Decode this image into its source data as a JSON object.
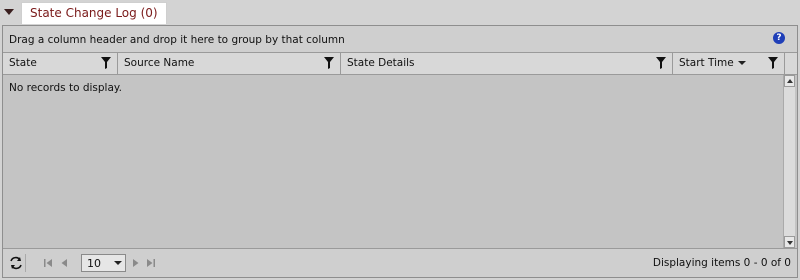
{
  "section": {
    "title": "State Change Log (0)"
  },
  "grid": {
    "group_panel_text": "Drag a column header and drop it here to group by that column",
    "help_label": "?",
    "columns": [
      {
        "label": "State"
      },
      {
        "label": "Source Name"
      },
      {
        "label": "State Details"
      },
      {
        "label": "Start Time"
      }
    ],
    "empty_text": "No records to display."
  },
  "pager": {
    "page_size": "10",
    "info": "Displaying items 0 - 0 of 0"
  },
  "colors": {
    "tab_title": "#7a1a1a",
    "help_icon": "#1f3fb8"
  }
}
